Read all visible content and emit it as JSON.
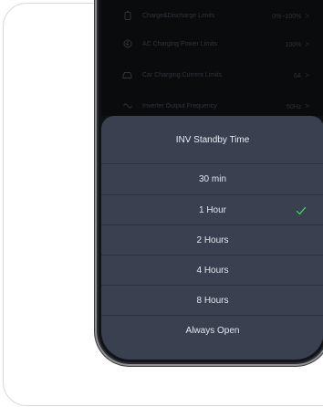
{
  "settings": {
    "rows": [
      {
        "label": "Charge&Discharge Limits",
        "value": "0%~100%",
        "icon": "battery-icon"
      },
      {
        "label": "AC Charging Power Limits",
        "value": "100%",
        "icon": "plug-icon"
      },
      {
        "label": "Car Charging Current Limits",
        "value": "6A",
        "icon": "car-icon"
      },
      {
        "label": "Inverter Output Frequency",
        "value": "50Hz",
        "icon": "wave-icon"
      }
    ],
    "chevron": ">"
  },
  "sheet": {
    "title": "INV Standby Time",
    "options": [
      {
        "label": "30 min",
        "selected": false
      },
      {
        "label": "1 Hour",
        "selected": true
      },
      {
        "label": "2 Hours",
        "selected": false
      },
      {
        "label": "4 Hours",
        "selected": false
      },
      {
        "label": "8 Hours",
        "selected": false
      },
      {
        "label": "Always Open",
        "selected": false
      }
    ],
    "check_icon": "checkmark-icon"
  },
  "colors": {
    "sheet_bg": "#394050",
    "check": "#4cd964"
  }
}
